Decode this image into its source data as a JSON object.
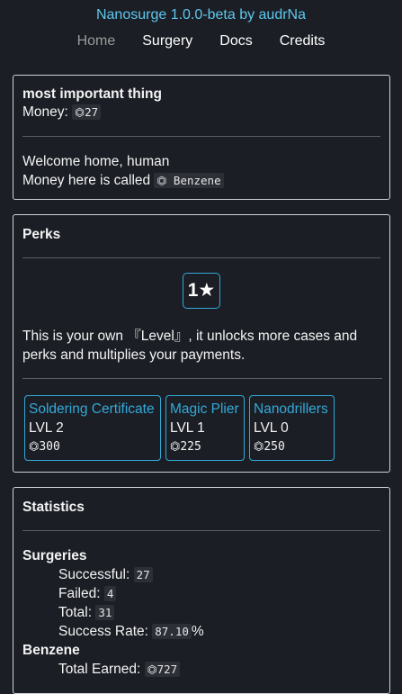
{
  "app": {
    "title": "Nanosurge 1.0.0-beta by audrNa"
  },
  "nav": {
    "items": [
      {
        "label": "Home",
        "active": true
      },
      {
        "label": "Surgery",
        "active": false
      },
      {
        "label": "Docs",
        "active": false
      },
      {
        "label": "Credits",
        "active": false
      }
    ]
  },
  "main_card": {
    "heading": "most important thing",
    "money_label": "Money:",
    "money_value": "⏣27",
    "welcome": "Welcome home, human",
    "currency_text": "Money here is called",
    "currency_name": "⏣ Benzene"
  },
  "perks": {
    "heading": "Perks",
    "level_badge": "1★",
    "level_description": "This is your own 『Level』, it unlocks more cases and perks and multiplies your payments.",
    "items": [
      {
        "name": "Soldering Certificate",
        "level": "LVL 2",
        "cost": "⏣300"
      },
      {
        "name": "Magic Plier",
        "level": "LVL 1",
        "cost": "⏣225"
      },
      {
        "name": "Nanodrillers",
        "level": "LVL 0",
        "cost": "⏣250"
      }
    ]
  },
  "stats": {
    "heading": "Statistics",
    "surgeries_heading": "Surgeries",
    "successful_label": "Successful:",
    "successful_value": "27",
    "failed_label": "Failed:",
    "failed_value": "4",
    "total_label": "Total:",
    "total_value": "31",
    "rate_label": "Success Rate:",
    "rate_value": "87.10",
    "rate_suffix": "%",
    "benzene_heading": "Benzene",
    "earned_label": "Total Earned:",
    "earned_value": "⏣727"
  },
  "colors": {
    "accent": "#33a9d8",
    "title": "#5ec8ee",
    "background": "#1b1e25"
  }
}
